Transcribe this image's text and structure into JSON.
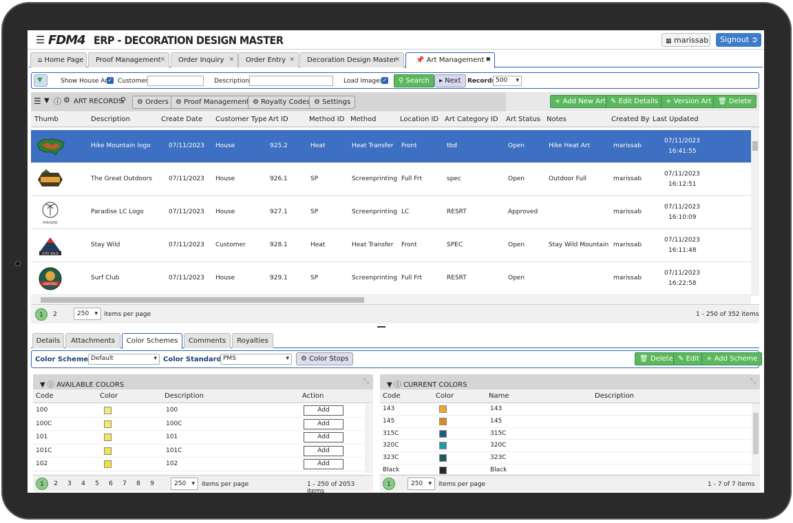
{
  "header": {
    "logo": "FDM4",
    "title": "ERP - DECORATION DESIGN MASTER",
    "user": "marissab",
    "signout": "Signout"
  },
  "tabs": [
    {
      "label": "Home Page"
    },
    {
      "label": "Proof Management"
    },
    {
      "label": "Order Inquiry"
    },
    {
      "label": "Order Entry"
    },
    {
      "label": "Decoration Design Master"
    },
    {
      "label": "Art Management"
    }
  ],
  "search": {
    "show_house_art": "Show House Art?",
    "customer_label": "Customer:",
    "customer_value": "",
    "description_label": "Description:",
    "description_value": "",
    "load_images": "Load Images?",
    "search_btn": "Search",
    "next_btn": "Next",
    "records_label": "Records:",
    "records_value": "500"
  },
  "grid": {
    "title": "ART RECORDS",
    "tool_buttons": [
      "Orders",
      "Proof Management",
      "Royalty Codes",
      "Settings"
    ],
    "action_buttons": [
      "Add New Art",
      "Edit Details",
      "Version Art",
      "Delete"
    ],
    "columns": [
      "Thumb",
      "Description",
      "Create Date",
      "Customer Type",
      "Art ID",
      "Method ID",
      "Method",
      "Location ID",
      "Art Category ID",
      "Art Status",
      "Notes",
      "Created By",
      "Last Updated"
    ],
    "rows": [
      {
        "description": "Hike Mountain logo",
        "create_date": "07/11/2023",
        "customer_type": "House",
        "art_id": "925.2",
        "method_id": "Heat",
        "method": "Heat Transfer",
        "location_id": "Front",
        "category": "tbd",
        "status": "Open",
        "notes": "Hike Heat Art",
        "created_by": "marissab",
        "updated_date": "07/11/2023",
        "updated_time": "16:41:55"
      },
      {
        "description": "The Great Outdoors",
        "create_date": "07/11/2023",
        "customer_type": "House",
        "art_id": "926.1",
        "method_id": "SP",
        "method": "Screenprinting",
        "location_id": "Full Frt",
        "category": "spec",
        "status": "Open",
        "notes": "Outdoor Full",
        "created_by": "marissab",
        "updated_date": "07/11/2023",
        "updated_time": "16:12:51"
      },
      {
        "description": "Paradise LC Logo",
        "create_date": "07/11/2023",
        "customer_type": "House",
        "art_id": "927.1",
        "method_id": "SP",
        "method": "Screenprinting",
        "location_id": "LC",
        "category": "RESRT",
        "status": "Approved",
        "notes": "",
        "created_by": "marissab",
        "updated_date": "07/11/2023",
        "updated_time": "16:10:09"
      },
      {
        "description": "Stay Wild",
        "create_date": "07/11/2023",
        "customer_type": "Customer",
        "art_id": "928.1",
        "method_id": "Heat",
        "method": "Heat Transfer",
        "location_id": "Front",
        "category": "SPEC",
        "status": "Open",
        "notes": "Stay Wild Mountain",
        "created_by": "marissab",
        "updated_date": "07/11/2023",
        "updated_time": "16:11:48"
      },
      {
        "description": "Surf Club",
        "create_date": "07/11/2023",
        "customer_type": "House",
        "art_id": "929.1",
        "method_id": "SP",
        "method": "Screenprinting",
        "location_id": "Full Frt",
        "category": "RESRT",
        "status": "Open",
        "notes": "",
        "created_by": "marissab",
        "updated_date": "07/11/2023",
        "updated_time": "16:22:58"
      }
    ],
    "thumb_text": {
      "paradise": "PARADISE",
      "staywild": "STAY WILD",
      "surfing": "SURFING"
    },
    "pager": {
      "pages": [
        "1",
        "2"
      ],
      "page_size": "250",
      "items_per_page": "items per page",
      "summary": "1 - 250 of 352 items"
    }
  },
  "lower_tabs": [
    "Details",
    "Attachments",
    "Color Schemes",
    "Comments",
    "Royalties"
  ],
  "scheme_bar": {
    "scheme_label": "Color Scheme:",
    "scheme_value": "Default",
    "standard_label": "Color Standard:",
    "standard_value": "PMS",
    "color_stops": "Color Stops",
    "delete": "Delete",
    "edit": "Edit",
    "add_scheme": "Add Scheme"
  },
  "available": {
    "title": "AVAILABLE COLORS",
    "columns": [
      "Code",
      "Color",
      "Description",
      "Action"
    ],
    "rows": [
      {
        "code": "100",
        "desc": "100",
        "color": "#f6ec7a"
      },
      {
        "code": "100C",
        "desc": "100C",
        "color": "#f4e96a"
      },
      {
        "code": "101",
        "desc": "101",
        "color": "#f3e65a"
      },
      {
        "code": "101C",
        "desc": "101C",
        "color": "#f2e44c"
      },
      {
        "code": "102",
        "desc": "102",
        "color": "#f1e233"
      }
    ],
    "add_label": "Add",
    "pager": {
      "pages": [
        "1",
        "2",
        "3",
        "4",
        "5",
        "6",
        "7",
        "8",
        "9"
      ],
      "page_size": "250",
      "items_per_page": "items per page",
      "summary": "1 - 250 of 2053 items"
    }
  },
  "current": {
    "title": "CURRENT COLORS",
    "columns": [
      "Code",
      "Color",
      "Name",
      "Description"
    ],
    "rows": [
      {
        "code": "143",
        "name": "143",
        "color": "#f0a533"
      },
      {
        "code": "145",
        "name": "145",
        "color": "#e0861f"
      },
      {
        "code": "315C",
        "name": "315C",
        "color": "#1e5f79"
      },
      {
        "code": "320C",
        "name": "320C",
        "color": "#1f9aa8"
      },
      {
        "code": "323C",
        "name": "323C",
        "color": "#1b5d63"
      },
      {
        "code": "Black",
        "name": "Black",
        "color": "#2b2623"
      }
    ],
    "pager": {
      "page": "1",
      "page_size": "250",
      "items_per_page": "items per page",
      "summary": "1 - 7 of 7 items"
    }
  }
}
